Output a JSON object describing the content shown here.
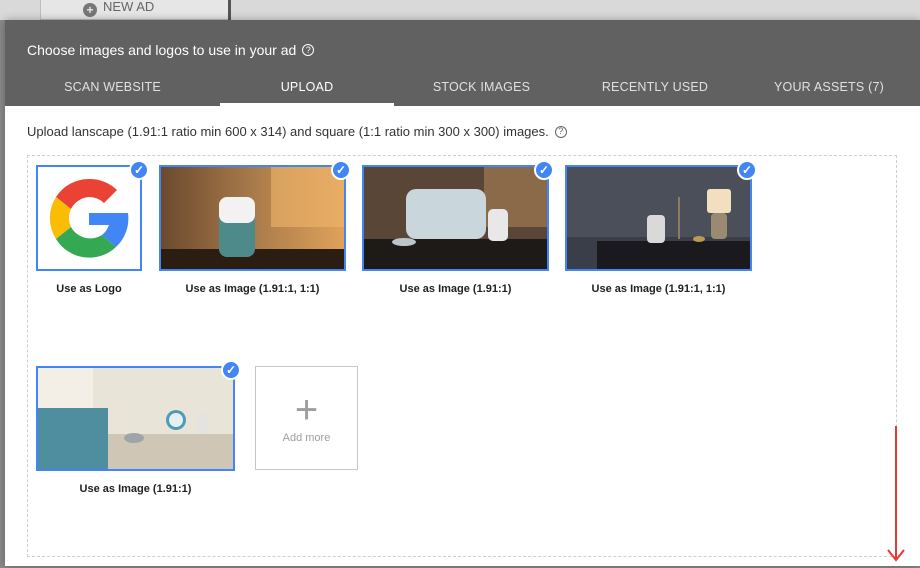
{
  "background": {
    "new_ad_label": "NEW AD"
  },
  "dialog": {
    "title": "Choose images and logos to use in your ad",
    "tabs": [
      {
        "label": "SCAN WEBSITE",
        "active": false
      },
      {
        "label": "UPLOAD",
        "active": true
      },
      {
        "label": "STOCK IMAGES",
        "active": false
      },
      {
        "label": "RECENTLY USED",
        "active": false
      },
      {
        "label": "YOUR ASSETS (7)",
        "active": false
      }
    ],
    "instruction": "Upload lanscape (1.91:1 ratio min 600 x 314) and square (1:1 ratio min 300 x 300) images.",
    "images": [
      {
        "caption": "Use as Logo",
        "selected": true,
        "kind": "google-logo"
      },
      {
        "caption": "Use as Image (1.91:1, 1:1)",
        "selected": true,
        "kind": "photo-speaker-warm"
      },
      {
        "caption": "Use as Image (1.91:1)",
        "selected": true,
        "kind": "photo-speakers-group"
      },
      {
        "caption": "Use as Image (1.91:1, 1:1)",
        "selected": true,
        "kind": "photo-speaker-lamp"
      },
      {
        "caption": "Use as Image (1.91:1)",
        "selected": true,
        "kind": "photo-speaker-bedside"
      }
    ],
    "add_more_label": "Add more"
  },
  "colors": {
    "header_bg": "#616161",
    "accent_blue": "#4285f4",
    "annotation_red": "#e53935"
  }
}
